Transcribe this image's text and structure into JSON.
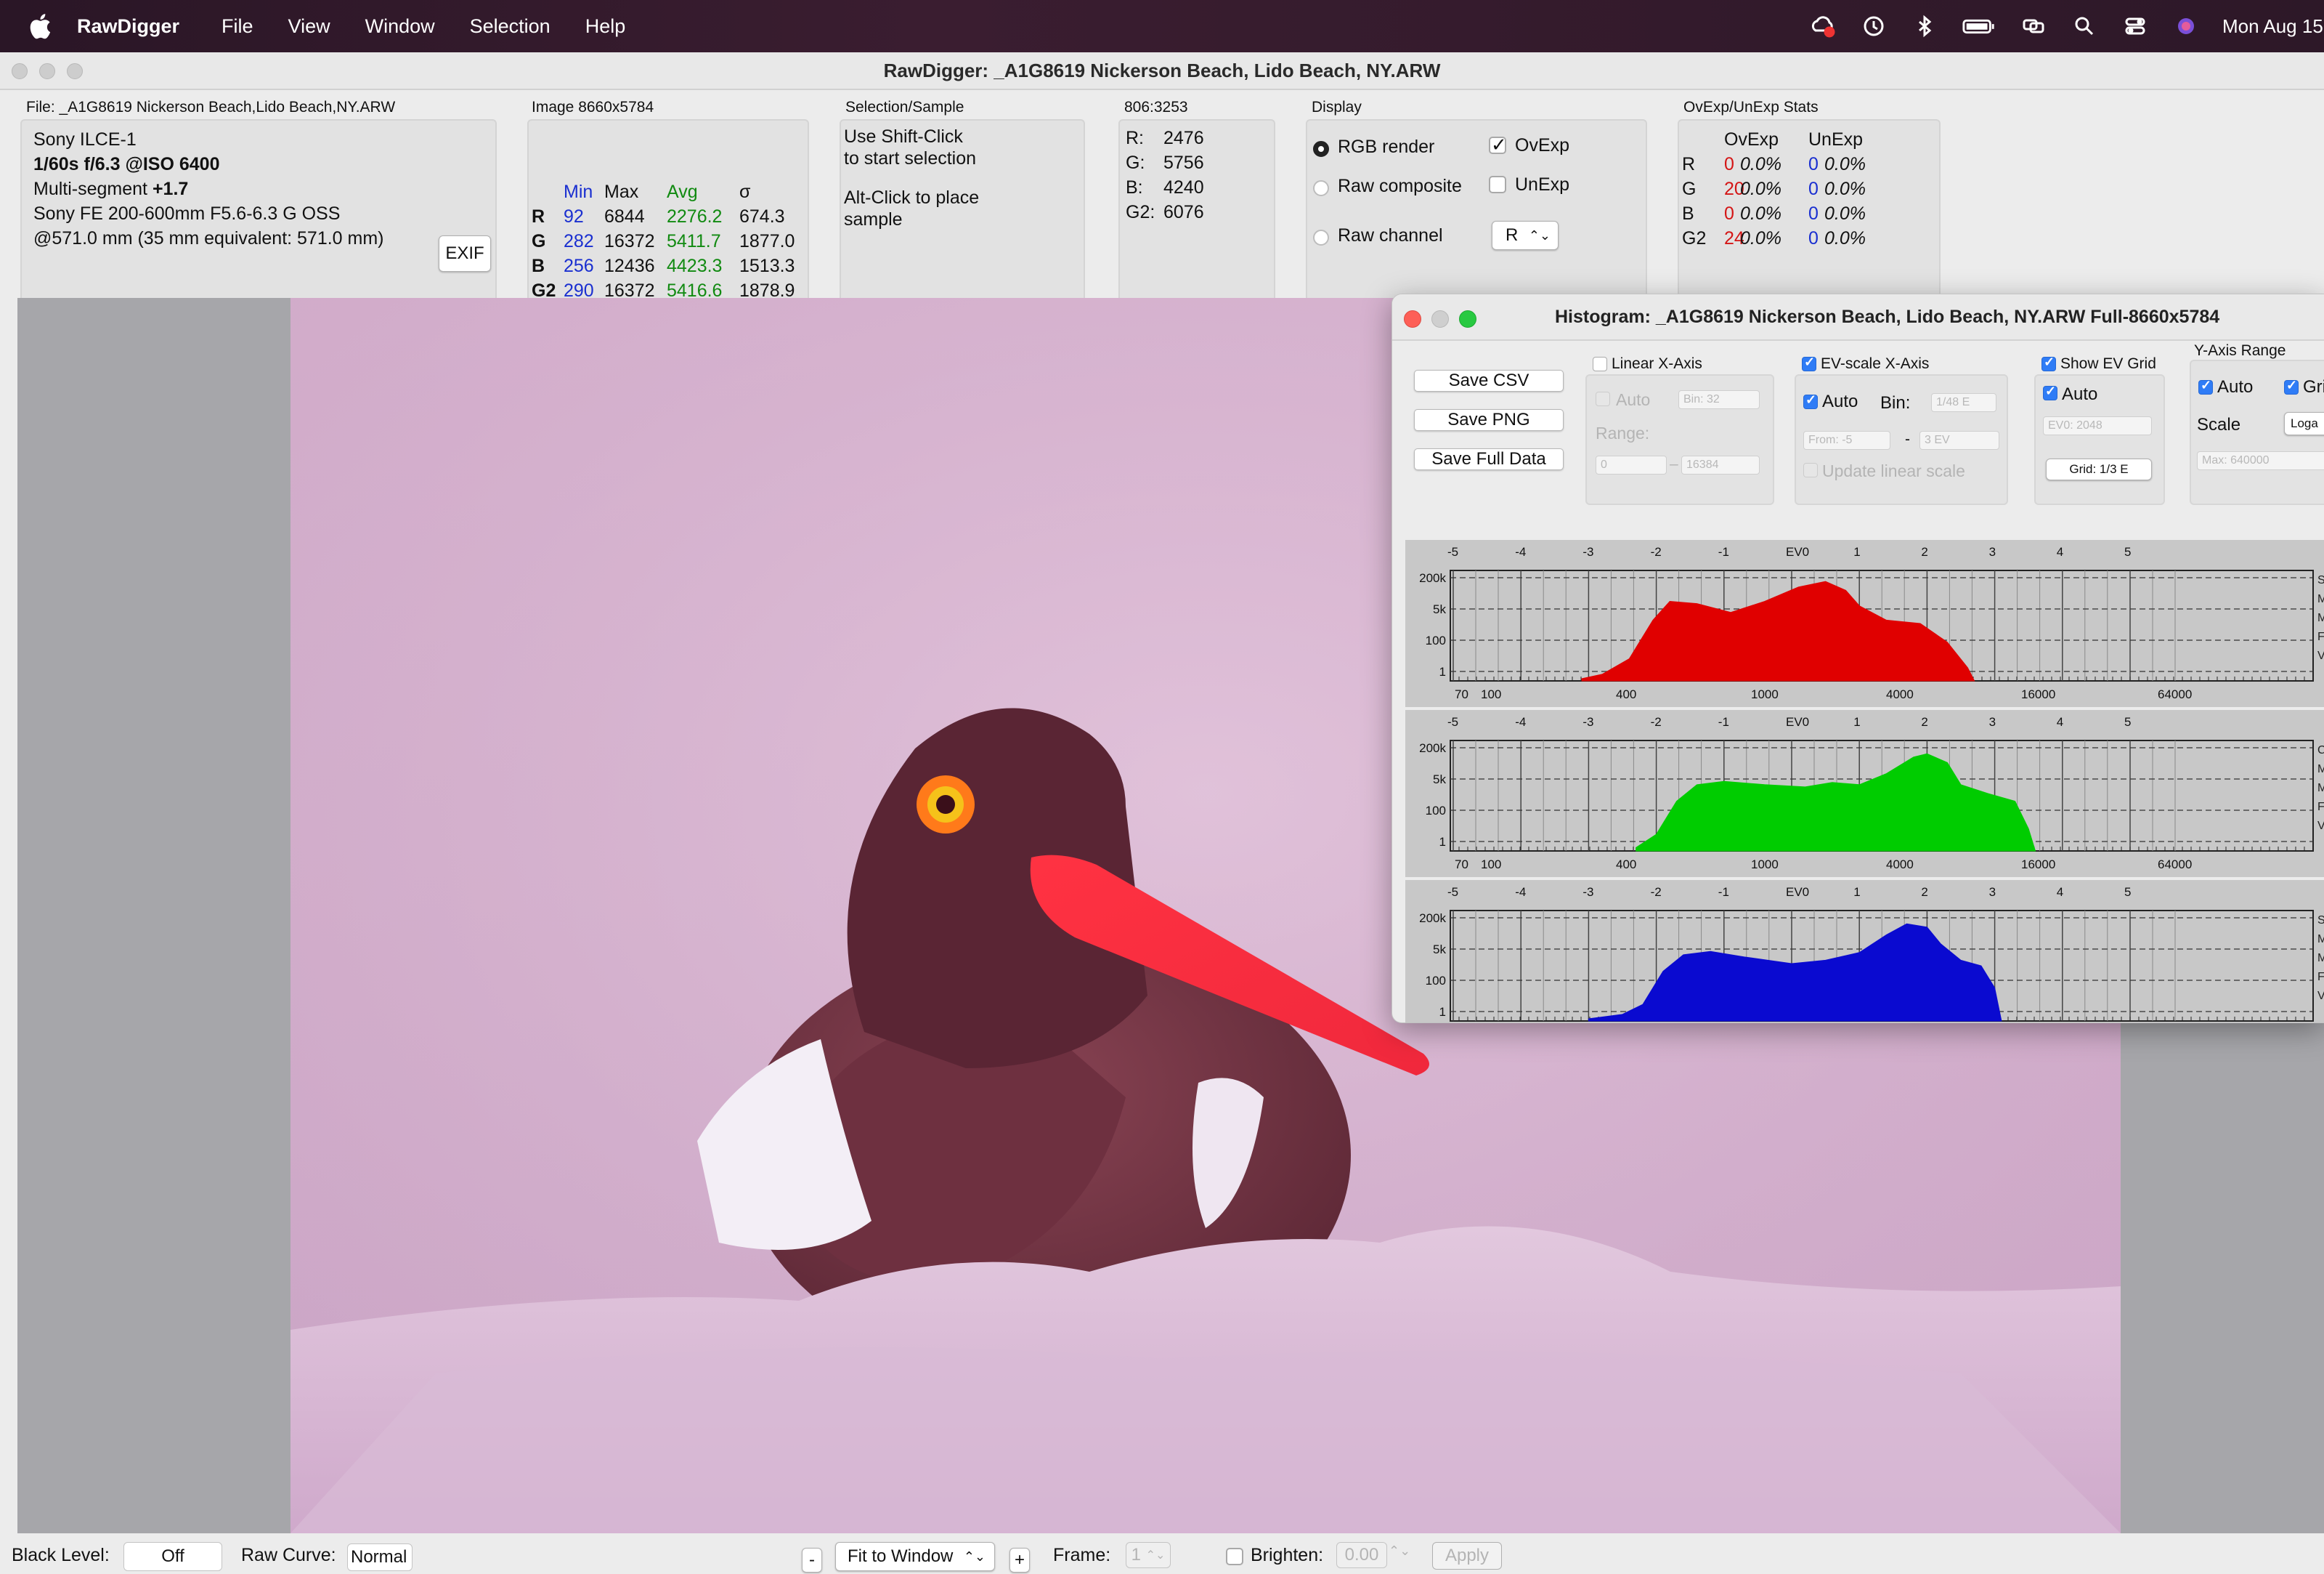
{
  "menubar": {
    "app": "RawDigger",
    "items": [
      "File",
      "View",
      "Window",
      "Selection",
      "Help"
    ],
    "clock": "Mon Aug 15"
  },
  "window": {
    "title": "RawDigger: _A1G8619 Nickerson Beach, Lido Beach, NY.ARW"
  },
  "file_panel": {
    "label": "File: _A1G8619 Nickerson Beach,Lido Beach,NY.ARW",
    "camera": "Sony ILCE-1",
    "exposure": "1/60s f/6.3 @ISO 6400",
    "metering_prefix": "Multi-segment",
    "metering_ev": "+1.7",
    "lens": "Sony FE 200-600mm F5.6-6.3 G OSS",
    "focal": "@571.0 mm (35 mm equivalent: 571.0 mm)",
    "exif_button": "EXIF"
  },
  "image_panel": {
    "label": "Image 8660x5784",
    "headers": [
      "Min",
      "Max",
      "Avg",
      "σ"
    ],
    "rows": [
      {
        "ch": "R",
        "min": "92",
        "max": "6844",
        "avg": "2276.2",
        "sigma": "674.3"
      },
      {
        "ch": "G",
        "min": "282",
        "max": "16372",
        "avg": "5411.7",
        "sigma": "1877.0"
      },
      {
        "ch": "B",
        "min": "256",
        "max": "12436",
        "avg": "4423.3",
        "sigma": "1513.3"
      },
      {
        "ch": "G2",
        "min": "290",
        "max": "16372",
        "avg": "5416.6",
        "sigma": "1878.9"
      }
    ]
  },
  "selection_panel": {
    "label": "Selection/Sample",
    "line1": "Use Shift-Click",
    "line2": "to start selection",
    "line3": "Alt-Click to place",
    "line4": "sample"
  },
  "coord_panel": {
    "label": "806:3253",
    "rows": [
      {
        "ch": "R:",
        "value": "2476"
      },
      {
        "ch": "G:",
        "value": "5756"
      },
      {
        "ch": "B:",
        "value": "4240"
      },
      {
        "ch": "G2:",
        "value": "6076"
      }
    ]
  },
  "display_panel": {
    "label": "Display",
    "rgb_render": "RGB render",
    "raw_composite": "Raw composite",
    "raw_channel": "Raw channel",
    "ovexp": "OvExp",
    "unexp": "UnExp",
    "channel_select": "R"
  },
  "stats_panel": {
    "label": "OvExp/UnExp Stats",
    "headers": [
      "OvExp",
      "UnExp"
    ],
    "rows": [
      {
        "ch": "R",
        "ov_n": "0",
        "ov_p": "0.0%",
        "un_n": "0",
        "un_p": "0.0%"
      },
      {
        "ch": "G",
        "ov_n": "20",
        "ov_p": "0.0%",
        "un_n": "0",
        "un_p": "0.0%"
      },
      {
        "ch": "B",
        "ov_n": "0",
        "ov_p": "0.0%",
        "un_n": "0",
        "un_p": "0.0%"
      },
      {
        "ch": "G2",
        "ov_n": "24",
        "ov_p": "0.0%",
        "un_n": "0",
        "un_p": "0.0%"
      }
    ]
  },
  "bottom": {
    "black_level_label": "Black Level:",
    "black_level_value": "Off",
    "raw_curve_label": "Raw Curve:",
    "raw_curve_value": "Normal",
    "minus": "-",
    "fit": "Fit to Window",
    "plus": "+",
    "frame_label": "Frame:",
    "frame_value": "1",
    "brighten_label": "Brighten:",
    "brighten_value": "0.00",
    "apply": "Apply"
  },
  "histogram": {
    "title": "Histogram: _A1G8619 Nickerson Beach, Lido Beach, NY.ARW Full-8660x5784",
    "save_csv": "Save CSV",
    "save_png": "Save PNG",
    "save_full": "Save Full Data",
    "linear_axis": "Linear X-Axis",
    "auto": "Auto",
    "bin32": "Bin: 32",
    "range": "Range:",
    "range_from": "0",
    "range_dash": "–",
    "range_to": "16384",
    "ev_axis": "EV-scale X-Axis",
    "bin_label": "Bin:",
    "bin_ev": "1/48 E",
    "from_ev": "From: -5",
    "dash": "-",
    "to_ev": "3 EV",
    "update_linear": "Update linear scale",
    "show_grid": "Show EV Grid",
    "ev0_value": "EV0: 2048",
    "grid_value": "Grid: 1/3 E",
    "y_range": "Y-Axis Range",
    "grid_chk": "Grid",
    "scale": "Scale",
    "scale_value": "Loga",
    "max_value": "Max: 640000",
    "ev_ticks": [
      "-5",
      "-4",
      "-3",
      "-2",
      "-1",
      "EV0",
      "1",
      "2",
      "3",
      "4",
      "5"
    ],
    "y_ticks": [
      "200k",
      "5k",
      "100",
      "1"
    ],
    "lin_ticks": [
      "70",
      "100",
      "400",
      "1000",
      "4000",
      "16000",
      "64000"
    ],
    "right_letters_1": [
      "S",
      "M",
      "M",
      "F",
      "V"
    ],
    "right_letters_2": [
      "C",
      "M",
      "M",
      "F",
      "V"
    ],
    "right_letters_3": [
      "S",
      "M",
      "M",
      "F",
      "V"
    ],
    "colors": {
      "red": "#e00000",
      "green": "#00cc00",
      "blue": "#0a0ad0"
    }
  }
}
